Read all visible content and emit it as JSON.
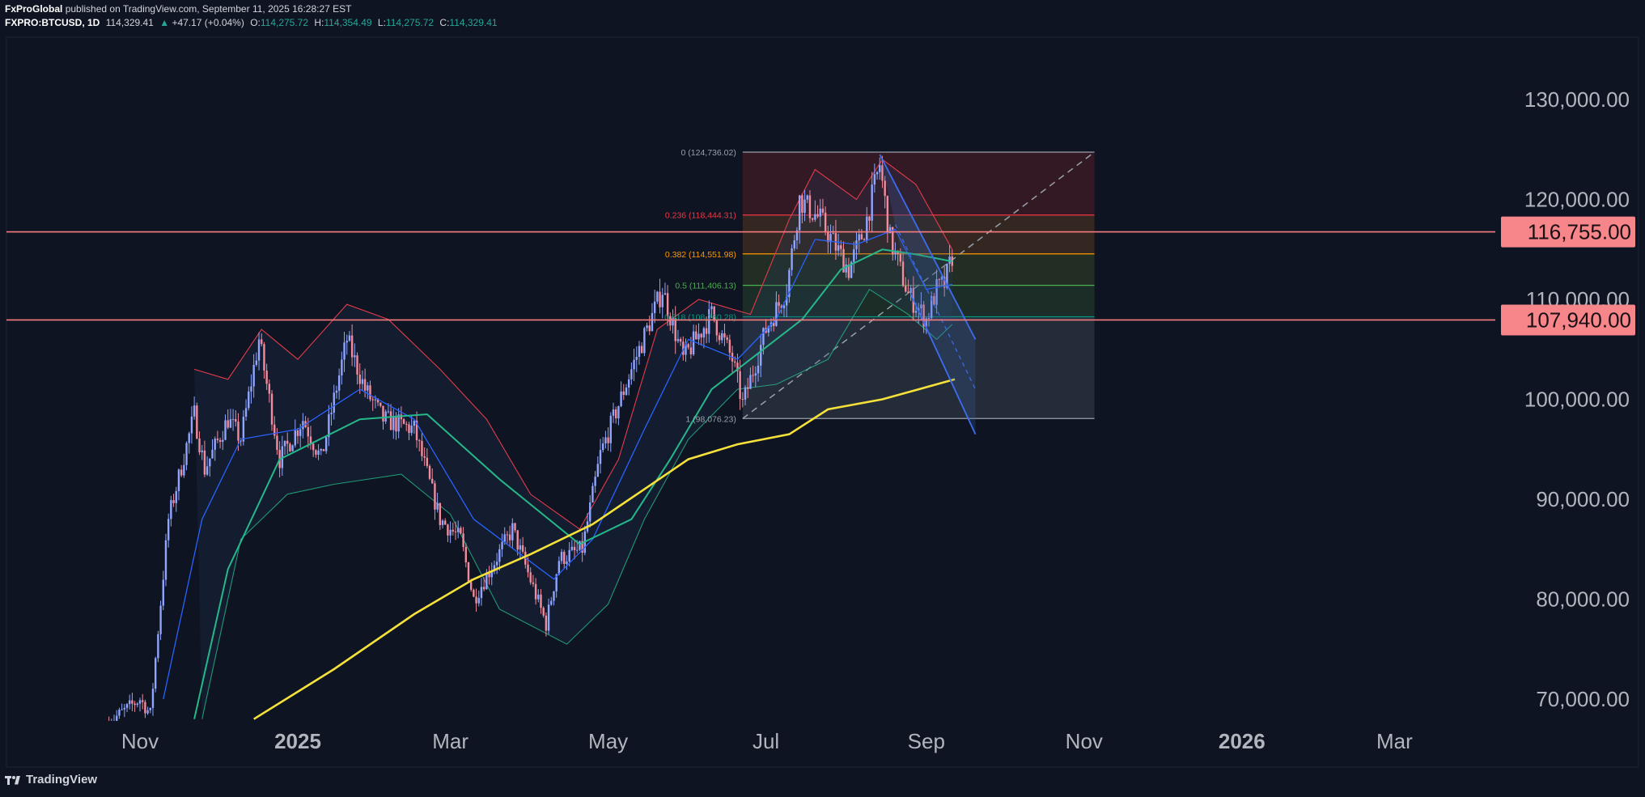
{
  "header": {
    "publisher": "FxProGlobal",
    "published_text": "published on TradingView.com, September 11, 2025 16:28:27 EST",
    "symbol": "FXPRO:BTCUSD, 1D",
    "last": "114,329.41",
    "change": "+47.17 (+0.04%)",
    "open_label": "O:",
    "open": "114,275.72",
    "high_label": "H:",
    "high": "114,354.49",
    "low_label": "L:",
    "low": "114,275.72",
    "close_label": "C:",
    "close": "114,329.41"
  },
  "footer": {
    "brand": "TradingView"
  },
  "colors": {
    "background": "#0e1421",
    "up_candle": "#8fa5ff",
    "down_candle": "#f28c9c",
    "ma_fast": "#2962ff",
    "ma_mid": "#26b88a",
    "ma_slow": "#f5e13a",
    "band": "#e23b4b",
    "resistance": "#f77c80",
    "channel": "#3d6cf0"
  },
  "chart_data": {
    "type": "candlestick",
    "symbol": "FXPRO:BTCUSD",
    "interval": "1D",
    "y_axis": {
      "ticks": [
        70000,
        80000,
        90000,
        100000,
        110000,
        120000,
        130000
      ],
      "tick_labels": [
        "70,000.00",
        "80,000.00",
        "90,000.00",
        "100,000.00",
        "110,000.00",
        "120,000.00",
        "130,000.00"
      ]
    },
    "x_axis": {
      "ticks": [
        "2024-11-01",
        "2025-01-01",
        "2025-03-01",
        "2025-05-01",
        "2025-07-01",
        "2025-09-01",
        "2025-11-01",
        "2026-01-01",
        "2026-03-01"
      ],
      "tick_labels": [
        "Nov",
        "2025",
        "Mar",
        "May",
        "Jul",
        "Sep",
        "Nov",
        "2026",
        "Mar"
      ],
      "bold_labels": [
        "2025",
        "2026"
      ]
    },
    "price_path": [
      [
        "2024-10-19",
        67500
      ],
      [
        "2024-11-01",
        70000
      ],
      [
        "2024-11-05",
        68500
      ],
      [
        "2024-11-12",
        88000
      ],
      [
        "2024-11-22",
        98500
      ],
      [
        "2024-11-26",
        93000
      ],
      [
        "2024-12-05",
        98000
      ],
      [
        "2024-12-10",
        96000
      ],
      [
        "2024-12-17",
        106000
      ],
      [
        "2024-12-25",
        94000
      ],
      [
        "2025-01-03",
        98000
      ],
      [
        "2025-01-10",
        94000
      ],
      [
        "2025-01-20",
        106000
      ],
      [
        "2025-01-27",
        101000
      ],
      [
        "2025-02-03",
        98000
      ],
      [
        "2025-02-15",
        97000
      ],
      [
        "2025-02-25",
        88000
      ],
      [
        "2025-03-05",
        86000
      ],
      [
        "2025-03-10",
        80000
      ],
      [
        "2025-03-25",
        87000
      ],
      [
        "2025-04-07",
        77500
      ],
      [
        "2025-04-12",
        84000
      ],
      [
        "2025-04-21",
        85000
      ],
      [
        "2025-04-28",
        94500
      ],
      [
        "2025-05-10",
        103000
      ],
      [
        "2025-05-22",
        111000
      ],
      [
        "2025-05-30",
        104000
      ],
      [
        "2025-06-10",
        108500
      ],
      [
        "2025-06-18",
        104000
      ],
      [
        "2025-06-22",
        99500
      ],
      [
        "2025-07-01",
        107000
      ],
      [
        "2025-07-09",
        111000
      ],
      [
        "2025-07-14",
        120000
      ],
      [
        "2025-07-22",
        118000
      ],
      [
        "2025-08-02",
        113000
      ],
      [
        "2025-08-08",
        117000
      ],
      [
        "2025-08-14",
        123500
      ],
      [
        "2025-08-18",
        116000
      ],
      [
        "2025-08-25",
        110500
      ],
      [
        "2025-09-01",
        108000
      ],
      [
        "2025-09-05",
        111000
      ],
      [
        "2025-09-08",
        111500
      ],
      [
        "2025-09-11",
        114329
      ]
    ],
    "ma_fast": [
      [
        "2024-11-10",
        70000
      ],
      [
        "2024-11-25",
        88000
      ],
      [
        "2024-12-10",
        96000
      ],
      [
        "2025-01-01",
        97000
      ],
      [
        "2025-01-25",
        101000
      ],
      [
        "2025-02-15",
        98000
      ],
      [
        "2025-03-10",
        88000
      ],
      [
        "2025-04-10",
        82000
      ],
      [
        "2025-04-25",
        86000
      ],
      [
        "2025-05-15",
        97000
      ],
      [
        "2025-06-01",
        106000
      ],
      [
        "2025-06-20",
        104000
      ],
      [
        "2025-07-05",
        108000
      ],
      [
        "2025-07-20",
        116000
      ],
      [
        "2025-08-05",
        115500
      ],
      [
        "2025-08-20",
        117000
      ],
      [
        "2025-09-01",
        111000
      ],
      [
        "2025-09-11",
        111500
      ]
    ],
    "ma_mid": [
      [
        "2024-11-22",
        68000
      ],
      [
        "2024-12-05",
        83000
      ],
      [
        "2024-12-25",
        94000
      ],
      [
        "2025-01-25",
        98000
      ],
      [
        "2025-02-20",
        98500
      ],
      [
        "2025-03-20",
        92000
      ],
      [
        "2025-04-20",
        85500
      ],
      [
        "2025-05-10",
        88000
      ],
      [
        "2025-05-25",
        94000
      ],
      [
        "2025-06-10",
        101000
      ],
      [
        "2025-06-25",
        104000
      ],
      [
        "2025-07-15",
        108000
      ],
      [
        "2025-07-30",
        113000
      ],
      [
        "2025-08-15",
        115000
      ],
      [
        "2025-08-28",
        114500
      ],
      [
        "2025-09-11",
        113800
      ]
    ],
    "ma_slow": [
      [
        "2024-12-15",
        68000
      ],
      [
        "2025-01-15",
        73000
      ],
      [
        "2025-02-15",
        78500
      ],
      [
        "2025-03-10",
        82000
      ],
      [
        "2025-04-01",
        84500
      ],
      [
        "2025-04-25",
        87500
      ],
      [
        "2025-05-15",
        91000
      ],
      [
        "2025-06-01",
        94000
      ],
      [
        "2025-06-20",
        95500
      ],
      [
        "2025-07-10",
        96500
      ],
      [
        "2025-07-25",
        99000
      ],
      [
        "2025-08-15",
        100000
      ],
      [
        "2025-09-12",
        102000
      ]
    ],
    "band_upper": [
      [
        "2024-11-22",
        103000
      ],
      [
        "2024-12-05",
        102000
      ],
      [
        "2024-12-18",
        107000
      ],
      [
        "2025-01-01",
        104000
      ],
      [
        "2025-01-20",
        109500
      ],
      [
        "2025-02-05",
        108000
      ],
      [
        "2025-02-25",
        103000
      ],
      [
        "2025-03-15",
        98000
      ],
      [
        "2025-04-01",
        90500
      ],
      [
        "2025-04-20",
        87000
      ],
      [
        "2025-05-05",
        94000
      ],
      [
        "2025-05-20",
        107000
      ],
      [
        "2025-06-05",
        110000
      ],
      [
        "2025-06-25",
        108500
      ],
      [
        "2025-07-10",
        118000
      ],
      [
        "2025-07-20",
        123000
      ],
      [
        "2025-08-05",
        120000
      ],
      [
        "2025-08-15",
        124000
      ],
      [
        "2025-08-28",
        121500
      ],
      [
        "2025-09-11",
        115000
      ]
    ],
    "band_lower": [
      [
        "2024-11-25",
        68000
      ],
      [
        "2024-12-10",
        86000
      ],
      [
        "2024-12-28",
        90500
      ],
      [
        "2025-01-15",
        91500
      ],
      [
        "2025-02-10",
        92500
      ],
      [
        "2025-03-01",
        88500
      ],
      [
        "2025-03-20",
        79000
      ],
      [
        "2025-04-15",
        75500
      ],
      [
        "2025-05-01",
        79500
      ],
      [
        "2025-05-15",
        88000
      ],
      [
        "2025-06-01",
        96000
      ],
      [
        "2025-06-20",
        101000
      ],
      [
        "2025-07-05",
        101500
      ],
      [
        "2025-07-25",
        104000
      ],
      [
        "2025-08-10",
        111000
      ],
      [
        "2025-08-25",
        108500
      ],
      [
        "2025-09-05",
        106000
      ],
      [
        "2025-09-11",
        107500
      ]
    ],
    "resistance_levels": [
      116755,
      107940
    ],
    "resistance_labels": [
      "116,755.00",
      "107,940.00"
    ],
    "fibonacci": {
      "x_start": "2025-06-22",
      "x_end": "2025-11-05",
      "levels": [
        {
          "ratio": 0,
          "ratio_label": "0",
          "price": 124736.02,
          "price_label": "(124,736.02)",
          "color": "#9aa0ab"
        },
        {
          "ratio": 0.236,
          "ratio_label": "0.236",
          "price": 118444.31,
          "price_label": "(118,444.31)",
          "color": "#f23645"
        },
        {
          "ratio": 0.382,
          "ratio_label": "0.382",
          "price": 114551.98,
          "price_label": "(114,551.98)",
          "color": "#ff9800"
        },
        {
          "ratio": 0.5,
          "ratio_label": "0.5",
          "price": 111406.13,
          "price_label": "(111,406.13)",
          "color": "#4caf50"
        },
        {
          "ratio": 0.618,
          "ratio_label": "0.618",
          "price": 108260.28,
          "price_label": "(108,260.28)",
          "color": "#089981"
        },
        {
          "ratio": 1,
          "ratio_label": "1",
          "price": 98076.23,
          "price_label": "(98,076.23)",
          "color": "#9aa0ab"
        }
      ],
      "trend_line": [
        [
          "2025-06-22",
          98076.23
        ],
        [
          "2025-11-05",
          124736.02
        ]
      ]
    },
    "channel": {
      "upper": [
        [
          "2025-08-14",
          124500
        ],
        [
          "2025-09-20",
          106000
        ]
      ],
      "lower": [
        [
          "2025-08-26",
          110500
        ],
        [
          "2025-09-20",
          96500
        ]
      ],
      "mid": [
        [
          "2025-08-20",
          117500
        ],
        [
          "2025-09-20",
          101000
        ]
      ]
    }
  }
}
